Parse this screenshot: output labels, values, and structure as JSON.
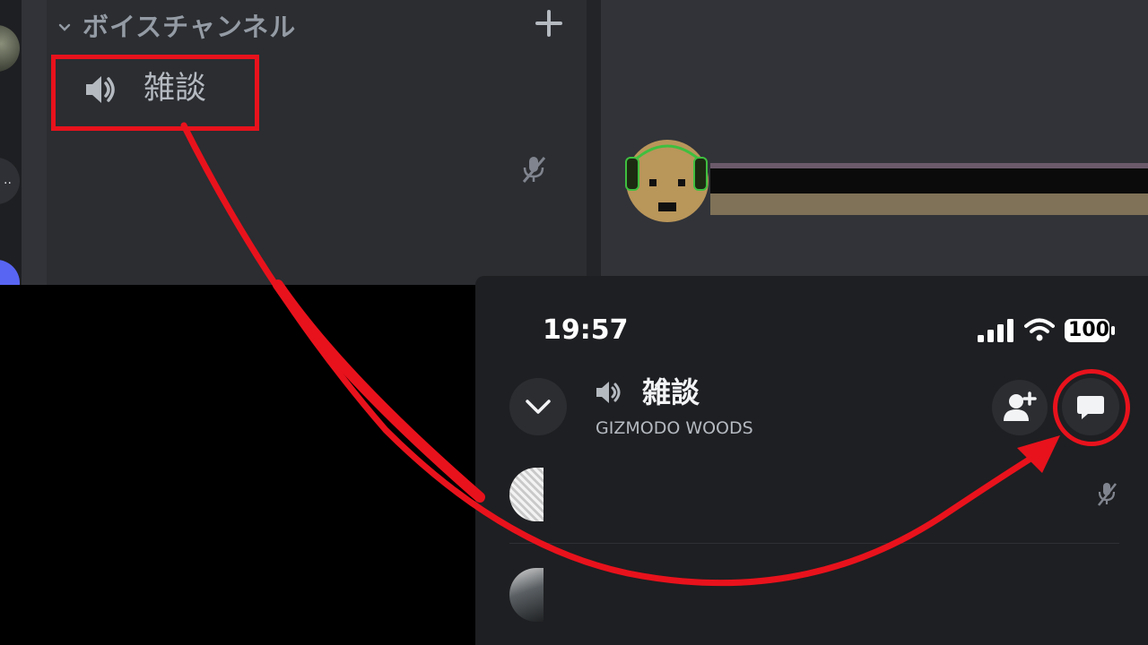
{
  "desktop": {
    "category": {
      "label": "ボイスチャンネル",
      "icon": "chevron-down-icon",
      "add_icon": "plus-icon"
    },
    "voice_channel": {
      "name": "雑談",
      "icon": "speaker-icon"
    },
    "muted_icon": "mic-muted-icon"
  },
  "mobile": {
    "status_bar": {
      "time": "19:57",
      "battery": "100"
    },
    "header": {
      "channel_name": "雑談",
      "server_name": "GIZMODO WOODS",
      "collapse_icon": "chevron-down-icon",
      "invite_icon": "add-person-icon",
      "chat_icon": "chat-bubble-icon"
    },
    "muted_icon": "mic-muted-icon"
  },
  "annotation": {
    "color": "#e8121c"
  },
  "colors": {
    "desktop_bg": "#313338",
    "sidebar_bg": "#2b2d31",
    "mobile_bg": "#1e1f22",
    "muted_text": "#949ba4"
  }
}
